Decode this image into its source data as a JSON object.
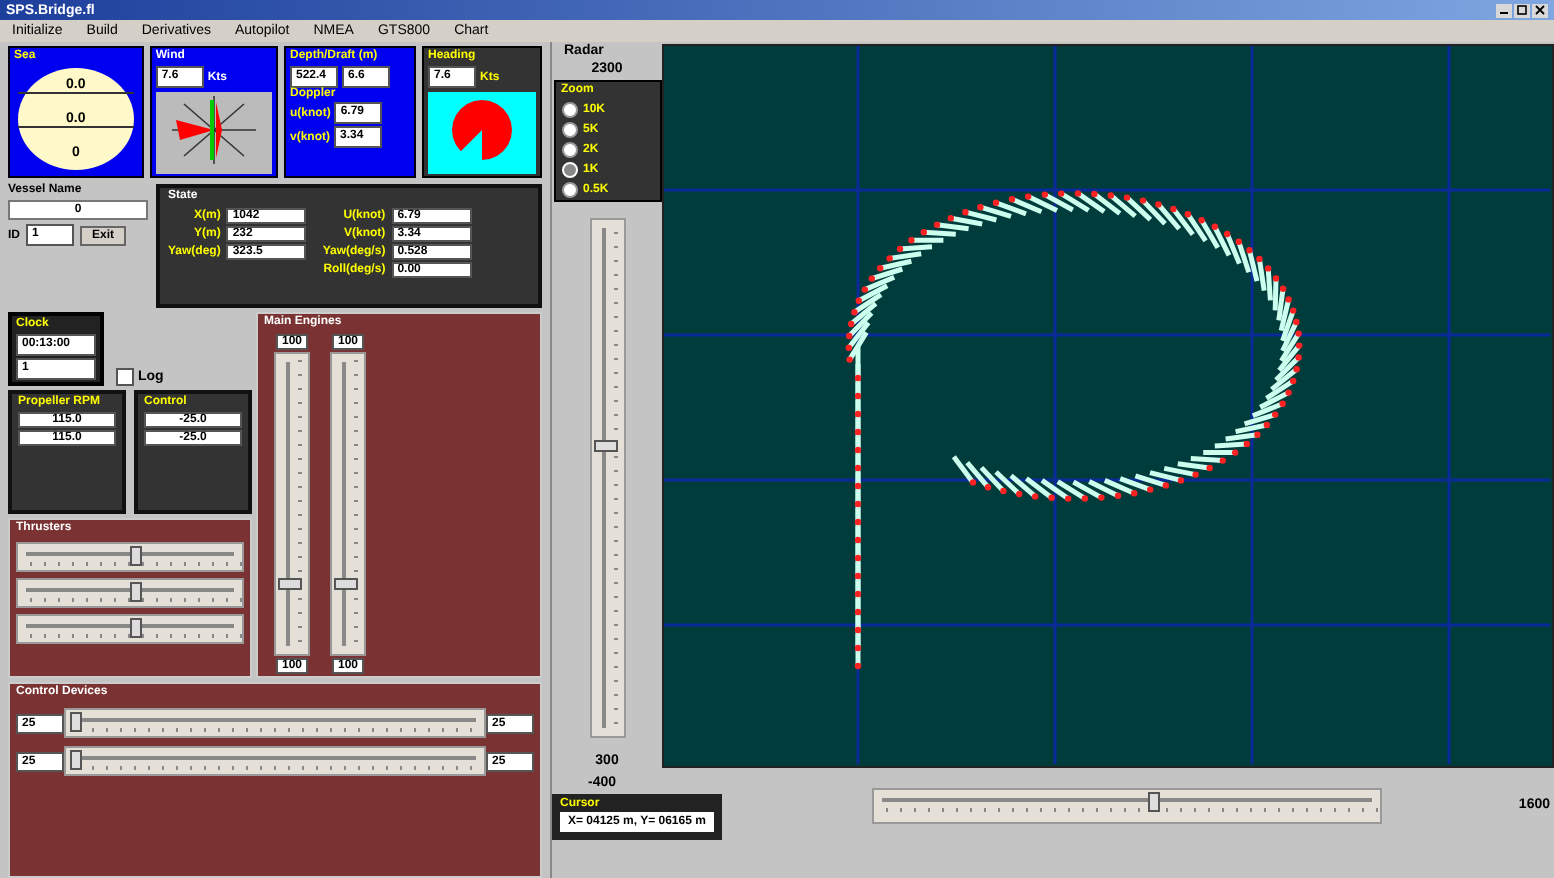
{
  "window": {
    "title": "SPS.Bridge.fl"
  },
  "menu": [
    "Initialize",
    "Build",
    "Derivatives",
    "Autopilot",
    "NMEA",
    "GTS800",
    "Chart"
  ],
  "sea": {
    "title": "Sea",
    "values": [
      "0.0",
      "0.0",
      "0"
    ]
  },
  "wind": {
    "title": "Wind",
    "speed": "7.6",
    "unit": "Kts"
  },
  "depth": {
    "title": "Depth/Draft (m)",
    "depth": "522.4",
    "draft": "6.6",
    "doppler_label": "Doppler",
    "fields": [
      {
        "label": "u(knot)",
        "value": "6.79"
      },
      {
        "label": "v(knot)",
        "value": "3.34"
      }
    ]
  },
  "heading": {
    "title": "Heading",
    "value": "7.6",
    "unit": "Kts"
  },
  "vessel": {
    "label": "Vessel Name",
    "name": "0",
    "number_label": "ID",
    "number": "1",
    "exit_button": "Exit"
  },
  "state": {
    "title": "State",
    "left": [
      {
        "label": "X(m)",
        "value": "1042"
      },
      {
        "label": "Y(m)",
        "value": "232"
      },
      {
        "label": "Yaw(deg)",
        "value": "323.5"
      }
    ],
    "right": [
      {
        "label": "U(knot)",
        "value": "6.79"
      },
      {
        "label": "V(knot)",
        "value": "3.34"
      },
      {
        "label": "Yaw(deg/s)",
        "value": "0.528"
      },
      {
        "label": "Roll(deg/s)",
        "value": "0.00"
      }
    ]
  },
  "clock": {
    "title": "Clock",
    "time": "00:13:00",
    "value": "1"
  },
  "log": {
    "label": "Log",
    "checked": false
  },
  "propeller": {
    "title": "Propeller RPM",
    "values": [
      "115.0",
      "115.0"
    ]
  },
  "control": {
    "title": "Control",
    "values": [
      "-25.0",
      "-25.0"
    ]
  },
  "main_engines": {
    "title": "Main Engines",
    "sliders": [
      {
        "max_label": "100",
        "min_label": "100",
        "level": 0.23
      },
      {
        "max_label": "100",
        "min_label": "100",
        "level": 0.23
      }
    ]
  },
  "thrusters": {
    "title": "Thrusters",
    "sliders": [
      {
        "level": 0.52
      },
      {
        "level": 0.52
      },
      {
        "level": 0.52
      }
    ]
  },
  "control_devices": {
    "title": "Control Devices",
    "rows": [
      {
        "start_label": "25",
        "end_label": "25",
        "level": 0.02
      },
      {
        "start_label": "25",
        "end_label": "25",
        "level": 0.02
      }
    ]
  },
  "radar": {
    "title": "Radar",
    "range_max": "2300",
    "range_min": "300",
    "x_min": "-400",
    "x_max": "1600",
    "vertical_slider": {
      "level": 0.56
    },
    "horizontal_slider": {
      "level": 0.55
    },
    "zoom": {
      "title": "Zoom",
      "options": [
        {
          "label": "10K",
          "selected": false
        },
        {
          "label": "5K",
          "selected": false
        },
        {
          "label": "2K",
          "selected": false
        },
        {
          "label": "1K",
          "selected": true
        },
        {
          "label": "0.5K",
          "selected": false
        }
      ]
    }
  },
  "cursor": {
    "title": "Cursor",
    "text": "X= 04125 m, Y= 06165 m"
  }
}
